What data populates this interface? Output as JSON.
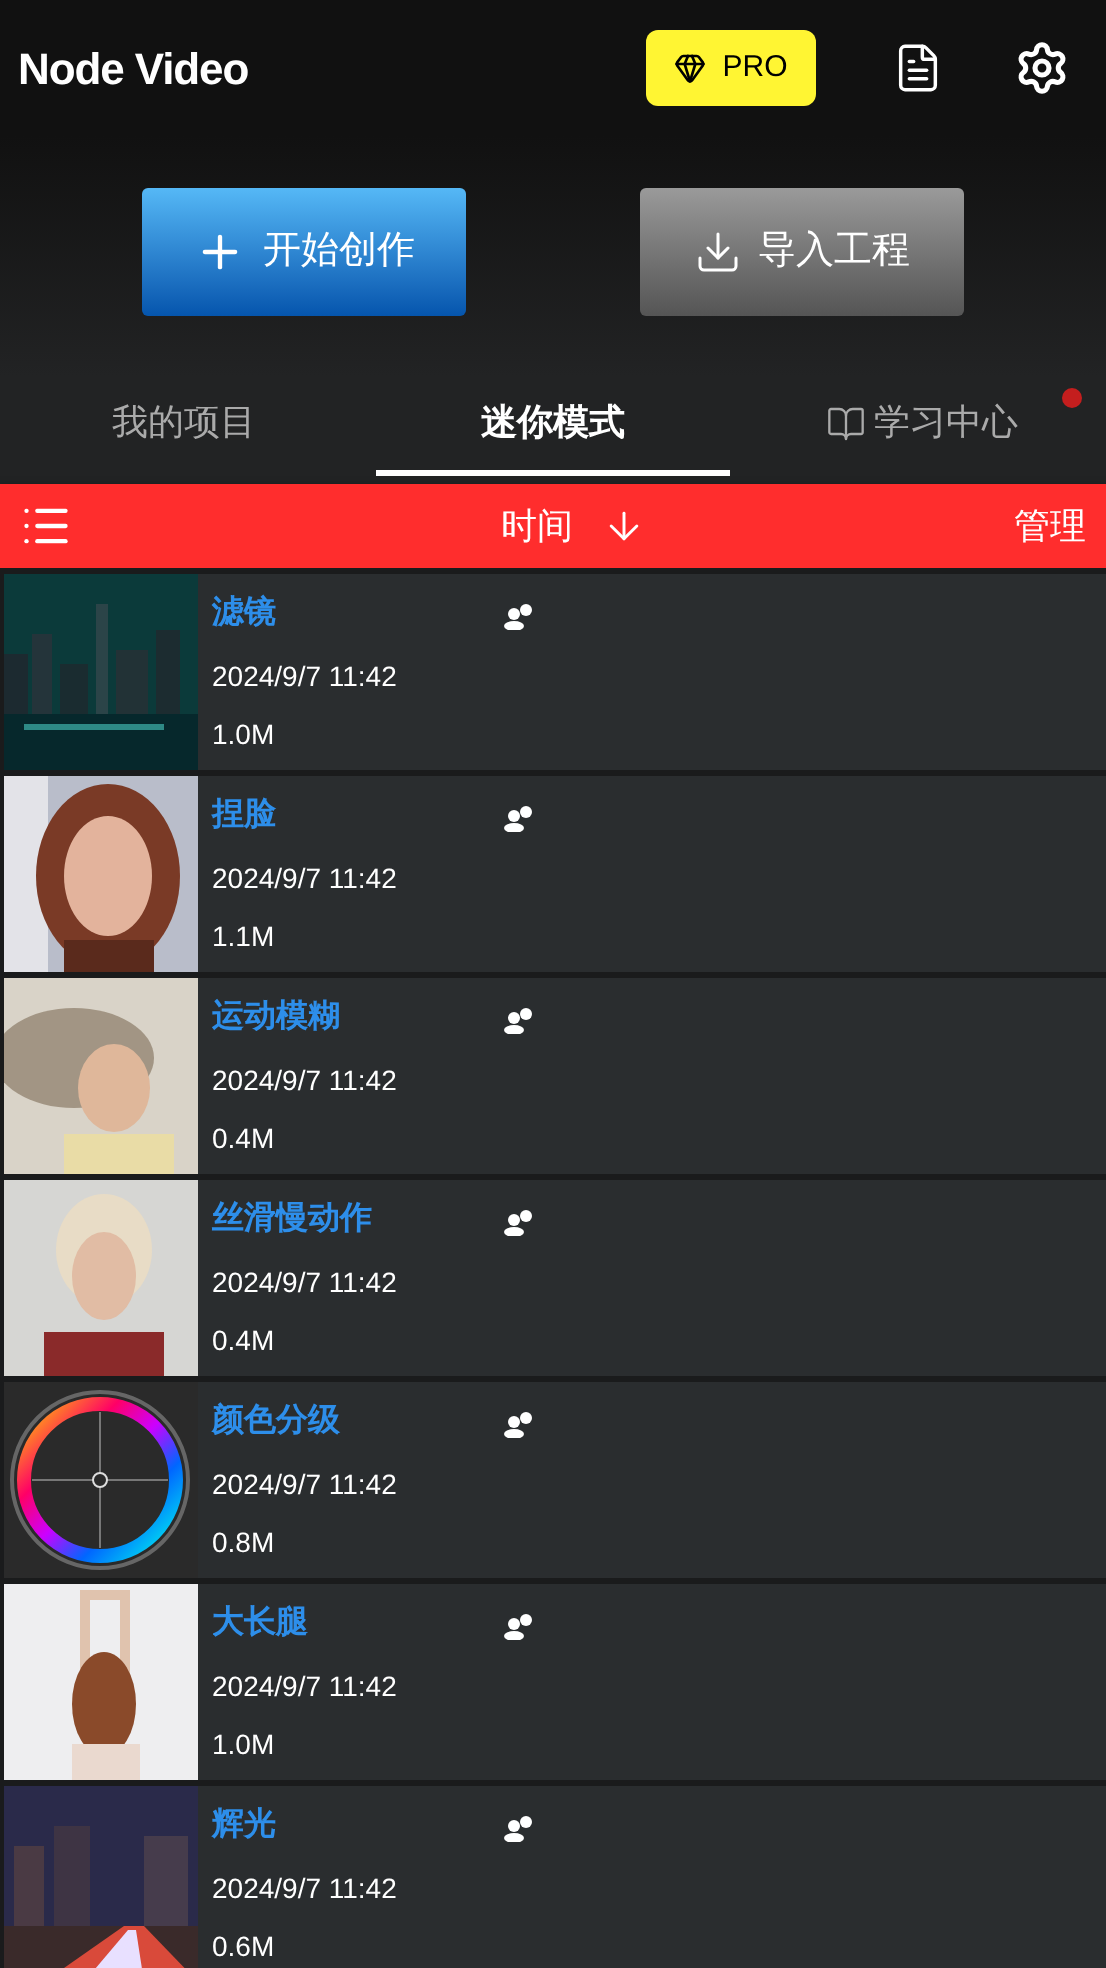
{
  "app_title": "Node Video",
  "pro_badge": "PRO",
  "actions": [
    {
      "kind": "create",
      "label": "开始创作"
    },
    {
      "kind": "import",
      "label": "导入工程"
    }
  ],
  "tabs": [
    {
      "label": "我的项目",
      "selected": false,
      "notification": false,
      "kind": "plain"
    },
    {
      "label": "迷你模式",
      "selected": true,
      "notification": false,
      "kind": "plain"
    },
    {
      "label": "学习中心",
      "selected": false,
      "notification": true,
      "kind": "book"
    }
  ],
  "sort_bar": {
    "sort_label": "时间",
    "manage": "管理"
  },
  "projects": [
    {
      "title": "滤镜",
      "date": "2024/9/7 11:42",
      "size": "1.0M"
    },
    {
      "title": "捏脸",
      "date": "2024/9/7 11:42",
      "size": "1.1M"
    },
    {
      "title": "运动模糊",
      "date": "2024/9/7 11:42",
      "size": "0.4M"
    },
    {
      "title": "丝滑慢动作",
      "date": "2024/9/7 11:42",
      "size": "0.4M"
    },
    {
      "title": "颜色分级",
      "date": "2024/9/7 11:42",
      "size": "0.8M",
      "thumbnail": {
        "kind": "color-wheel"
      }
    },
    {
      "title": "大长腿",
      "date": "2024/9/7 11:42",
      "size": "1.0M"
    },
    {
      "title": "辉光",
      "date": "2024/9/7 11:42",
      "size": "0.6M"
    }
  ]
}
